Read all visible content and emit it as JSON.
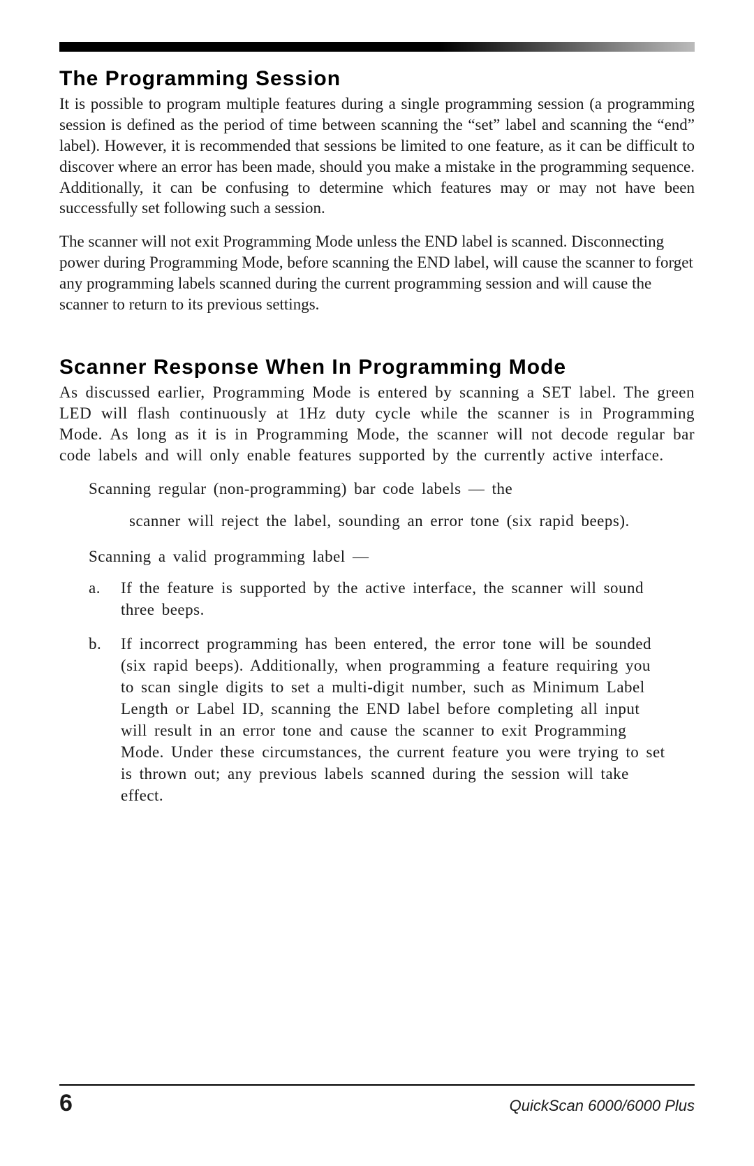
{
  "sections": {
    "s1": {
      "title": "The Programming Session",
      "p1": "It is possible to program multiple features during a single programming session (a programming session is defined as the period of time between scanning the “set” label and scanning the “end” label).  However, it is recommended that sessions be limited to one feature, as it can be difficult to discover where an error has been made, should you make a mistake in the programming sequence.  Additionally, it can be confusing to determine which features may or may not have been successfully set following such a session.",
      "p2": "The scanner will not exit Programming Mode unless the END label is scanned. Disconnecting power during Programming Mode, before scanning the END label, will cause the scanner to forget any programming labels scanned during the current programming session and will cause the scanner to return to its previous settings."
    },
    "s2": {
      "title": "Scanner Response When In Programming Mode",
      "p1": "As discussed earlier, Programming Mode is entered by scanning a SET label.  The green LED will flash continuously at 1Hz duty cycle while the scanner is in Programming Mode.  As long as it is in Programming Mode, the scanner will not decode regular bar code labels and will only enable features supported by the currently active interface.",
      "note1_intro": "Scanning regular (non-programming) bar code labels  —  the",
      "note1_body": "scanner will reject the label, sounding an error tone (six rapid beeps).",
      "note2_intro": "Scanning a valid programming label  —",
      "list": {
        "a_marker": "a.",
        "a_text": "If the feature is supported by the active interface, the scanner will sound three beeps.",
        "b_marker": "b.",
        "b_text": "If incorrect programming has been entered, the error tone will be sounded (six rapid beeps).  Additionally, when programming a feature requiring you to scan single digits to set a multi-digit number, such as Minimum Label Length or Label ID, scanning the END label before completing all input will result in an error tone and cause the scanner to exit Programming Mode.  Under these circumstances, the current feature you were trying to set is thrown out; any previous labels scanned during the session will take effect."
      }
    }
  },
  "footer": {
    "page_number": "6",
    "doc_id": "QuickScan 6000/6000 Plus"
  }
}
